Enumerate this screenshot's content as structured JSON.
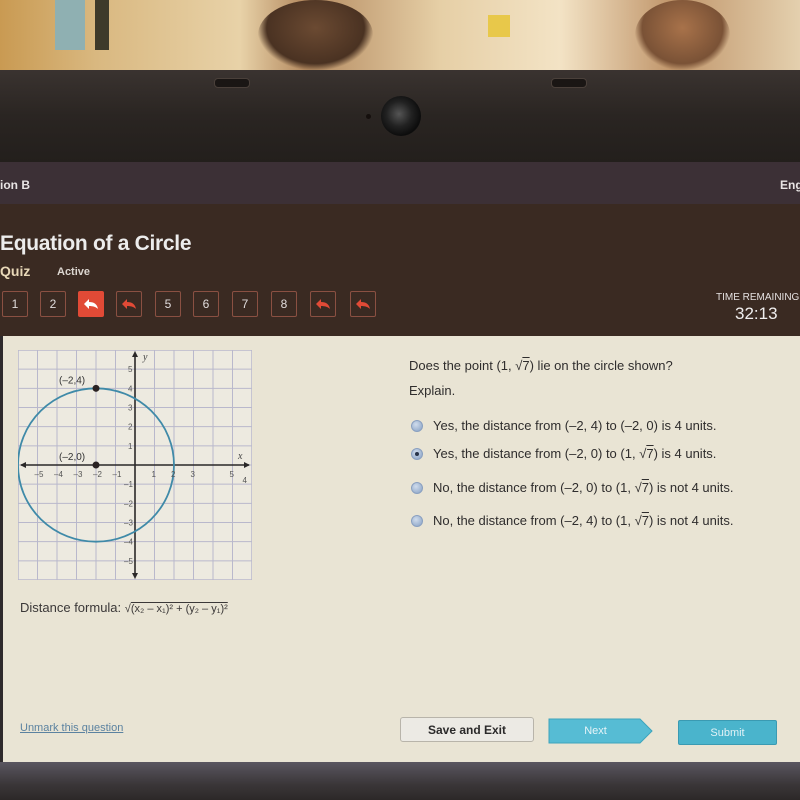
{
  "topbar": {
    "left_text": "ion B",
    "right_text": "Eng"
  },
  "header": {
    "title": "Equation of a Circle",
    "type_label": "Quiz",
    "status_label": "Active",
    "question_nav": [
      {
        "label": "1",
        "state": "normal"
      },
      {
        "label": "2",
        "state": "normal"
      },
      {
        "label": "",
        "state": "current-marked",
        "icon": "return-arrow-icon"
      },
      {
        "label": "",
        "state": "marked",
        "icon": "return-arrow-icon"
      },
      {
        "label": "5",
        "state": "normal"
      },
      {
        "label": "6",
        "state": "normal"
      },
      {
        "label": "7",
        "state": "normal"
      },
      {
        "label": "8",
        "state": "normal"
      },
      {
        "label": "",
        "state": "marked",
        "icon": "return-arrow-icon"
      },
      {
        "label": "",
        "state": "marked",
        "icon": "return-arrow-icon"
      }
    ],
    "timer_label": "TIME REMAINING",
    "timer_value": "32:13"
  },
  "graph": {
    "x_axis_label": "x",
    "y_axis_label": "y",
    "x_ticks": [
      "-5",
      "-4",
      "-3",
      "-2",
      "-1",
      "1",
      "2",
      "3",
      "5",
      "4"
    ],
    "y_ticks": [
      "5",
      "4",
      "3",
      "2",
      "1",
      "-1",
      "-2",
      "-3",
      "-4",
      "-5"
    ],
    "points": [
      {
        "label": "(–2,4)",
        "x": -2,
        "y": 4
      },
      {
        "label": "(–2,0)",
        "x": -2,
        "y": 0
      }
    ],
    "circle": {
      "center_x": -2,
      "center_y": 0,
      "radius": 4
    },
    "colors": {
      "circle": "#3f8aa8",
      "grid": "#b9b8cc",
      "axis": "#2a2828"
    }
  },
  "formula": {
    "label": "Distance formula:",
    "expression": "(x₂ – x₁)² + (y₂ – y₁)²"
  },
  "question": {
    "prefix": "Does the point (1, ",
    "sqrt_value": "7",
    "suffix": ") lie on the circle shown?",
    "instruction": "Explain.",
    "options": [
      {
        "text_before": "Yes, the distance from (–2, 4) to (–2, 0) is 4 units.",
        "sqrt": "",
        "text_after": "",
        "selected": false
      },
      {
        "text_before": "Yes, the distance from (–2, 0) to (1, ",
        "sqrt": "7",
        "text_after": ") is 4 units.",
        "selected": true
      },
      {
        "text_before": "No, the distance from (–2, 0) to (1, ",
        "sqrt": "7",
        "text_after": ") is not 4 units.",
        "selected": false
      },
      {
        "text_before": "No, the distance from (–2, 4) to (1, ",
        "sqrt": "7",
        "text_after": ") is not 4 units.",
        "selected": false
      }
    ]
  },
  "footer": {
    "unmark_link": "Unmark this question",
    "save_button": "Save and Exit",
    "next_button": "Next",
    "submit_button": "Submit"
  },
  "colors": {
    "accent_marked": "#e14a36",
    "button_teal": "#4ab4cc",
    "content_bg": "#e9e4d4",
    "header_bg": "#3a2a22"
  }
}
